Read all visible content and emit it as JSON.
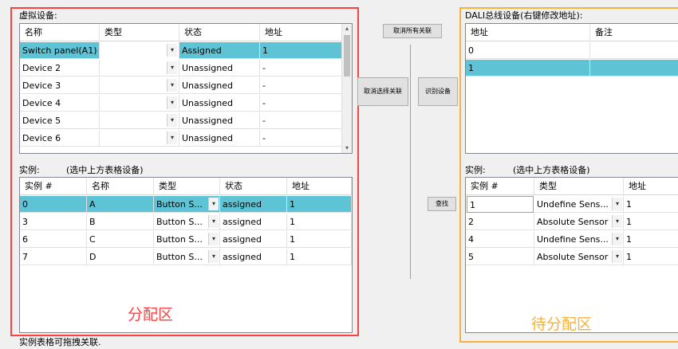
{
  "left": {
    "virtual_label": "虚拟设备:",
    "virtual_headers": [
      "名称",
      "类型",
      "状态",
      "地址"
    ],
    "virtual_rows": [
      {
        "name": "Switch panel(A1)",
        "type": "",
        "state": "Assigned",
        "addr": "1",
        "selected": true
      },
      {
        "name": "Device 2",
        "type": "",
        "state": "Unassigned",
        "addr": "-"
      },
      {
        "name": "Device 3",
        "type": "",
        "state": "Unassigned",
        "addr": "-"
      },
      {
        "name": "Device 4",
        "type": "",
        "state": "Unassigned",
        "addr": "-"
      },
      {
        "name": "Device 5",
        "type": "",
        "state": "Unassigned",
        "addr": "-"
      },
      {
        "name": "Device 6",
        "type": "",
        "state": "Unassigned",
        "addr": "-"
      }
    ],
    "instance_label": "实例:",
    "instance_hint": "(选中上方表格设备)",
    "instance_headers": [
      "实例 #",
      "名称",
      "类型",
      "状态",
      "地址"
    ],
    "instance_rows": [
      {
        "id": "0",
        "name": "A",
        "type": "Button S...",
        "state": "assigned",
        "addr": "1",
        "selected": true
      },
      {
        "id": "3",
        "name": "B",
        "type": "Button S...",
        "state": "assigned",
        "addr": "1"
      },
      {
        "id": "6",
        "name": "C",
        "type": "Button S...",
        "state": "assigned",
        "addr": "1"
      },
      {
        "id": "7",
        "name": "D",
        "type": "Button S...",
        "state": "assigned",
        "addr": "1"
      }
    ],
    "zone_label": "分配区",
    "footer_hint": "实例表格可拖拽关联."
  },
  "middle": {
    "cancel_all": "取消所有关联",
    "cancel_selected": "取消选择关联",
    "identify": "识别设备",
    "find": "查找"
  },
  "right": {
    "dali_label": "DALI总线设备(右键修改地址):",
    "dali_headers": [
      "地址",
      "备注"
    ],
    "dali_rows": [
      {
        "addr": "0",
        "note": ""
      },
      {
        "addr": "1",
        "note": "",
        "selected": true
      }
    ],
    "instance_label": "实例:",
    "instance_hint": "(选中上方表格设备)",
    "instance_headers": [
      "实例 #",
      "类型",
      "地址"
    ],
    "instance_rows": [
      {
        "id": "1",
        "type": "Undefine Sens...",
        "addr": "1"
      },
      {
        "id": "2",
        "type": "Absolute Sensor",
        "addr": "1"
      },
      {
        "id": "4",
        "type": "Undefine Sens...",
        "addr": "1"
      },
      {
        "id": "5",
        "type": "Absolute Sensor",
        "addr": "1"
      }
    ],
    "zone_label": "待分配区"
  },
  "colors": {
    "left_zone": "#ff4040",
    "right_zone": "#f5b23c",
    "selected_row": "#5fc3d6"
  }
}
